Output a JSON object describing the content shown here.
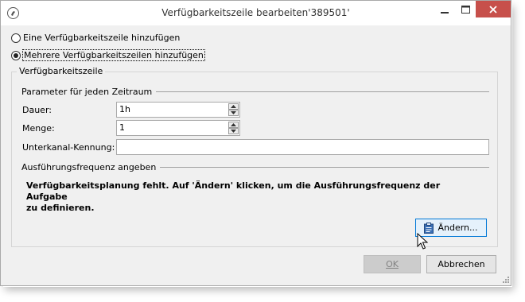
{
  "window": {
    "title": "Verfügbarkeitszeile bearbeiten'389501'"
  },
  "options": {
    "single": "Eine Verfügbarkeitszeile hinzufügen",
    "multiple": "Mehrere Verfügbarkeitszeilen hinzufügen",
    "selected": "multiple"
  },
  "group": {
    "title": "Verfügbarkeitszeile",
    "params_section": "Parameter für jeden Zeitraum",
    "duration_label": "Dauer:",
    "duration_value": "1h",
    "quantity_label": "Menge:",
    "quantity_value": "1",
    "subchannel_label": "Unterkanal-Kennung:",
    "subchannel_value": "",
    "frequency_section": "Ausführungsfrequenz angeben",
    "warning_line1": "Verfügbarkeitsplanung fehlt. Auf 'Ändern' klicken, um die Ausführungsfrequenz der Aufgabe",
    "warning_line2": "zu definieren.",
    "change_button": "Ändern..."
  },
  "footer": {
    "ok_button": "OK",
    "cancel_button": "Abbrechen"
  },
  "colors": {
    "close_button": "#c7504b",
    "hover_accent": "#0078d7",
    "icon_blue": "#3a6fb5"
  },
  "icons": {
    "app": "app-logo-icon",
    "change": "clipboard-icon",
    "cursor": "mouse-pointer-icon"
  }
}
